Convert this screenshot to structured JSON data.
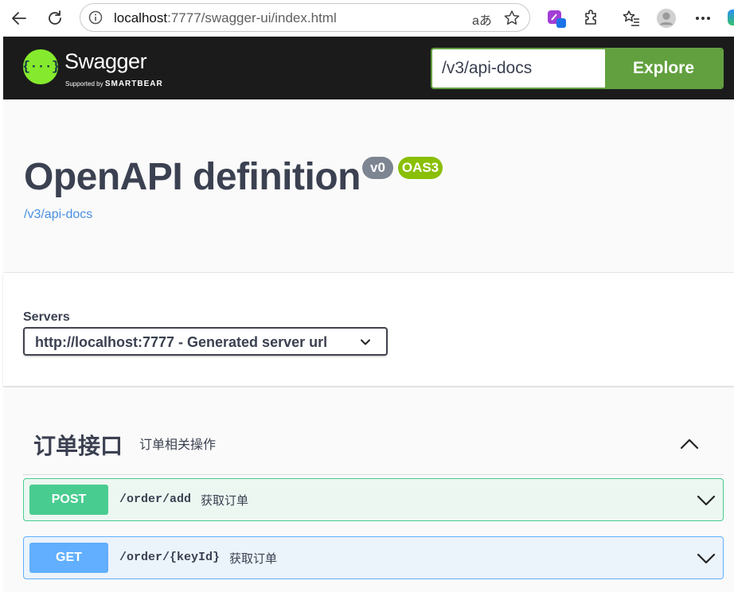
{
  "browser": {
    "url_host": "localhost",
    "url_rest": ":7777/swagger-ui/index.html",
    "translate_label": "aあ"
  },
  "topbar": {
    "brand": "Swagger",
    "supported_prefix": "Supported by ",
    "supported_brand": "SMARTBEAR",
    "spec_url": "/v3/api-docs",
    "explore_label": "Explore"
  },
  "info": {
    "title": "OpenAPI definition",
    "version_badge": "v0",
    "oas_badge": "OAS3",
    "spec_link": "/v3/api-docs"
  },
  "servers": {
    "label": "Servers",
    "selected": "http://localhost:7777 - Generated server url"
  },
  "tag": {
    "name": "订单接口",
    "description": "订单相关操作"
  },
  "operations": [
    {
      "method": "POST",
      "path": "/order/add",
      "summary": "获取订单"
    },
    {
      "method": "GET",
      "path": "/order/{keyId}",
      "summary": "获取订单"
    }
  ],
  "colors": {
    "swagger_green": "#85ea2d",
    "explore_green": "#62a03f",
    "post": "#49cc90",
    "get": "#61affe",
    "link": "#4990e2",
    "text": "#3b4151"
  }
}
